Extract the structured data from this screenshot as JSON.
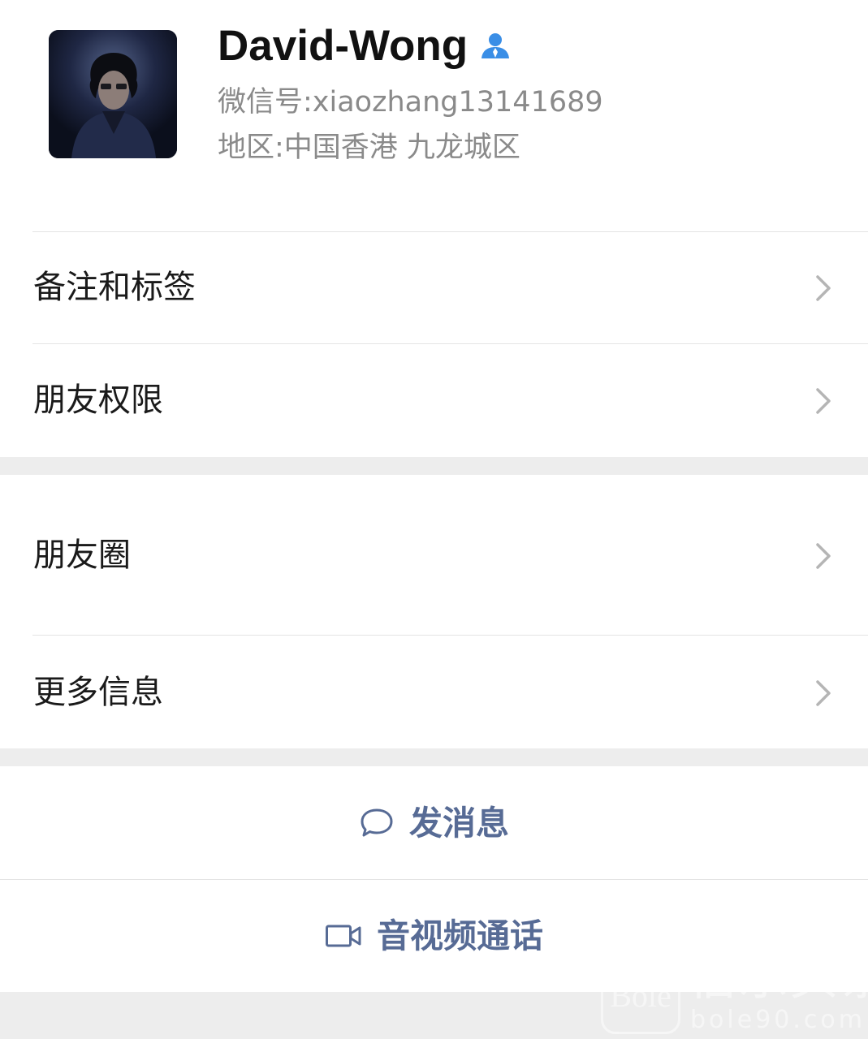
{
  "profile": {
    "name": "David-Wong",
    "wechat_id_label": "微信号:",
    "wechat_id": "xiaozhang13141689",
    "region_label": "地区:",
    "region": "中国香港 九龙城区",
    "contact_icon": "person-icon"
  },
  "menu_group_1": [
    {
      "label": "备注和标签",
      "icon": "chevron-right-icon"
    },
    {
      "label": "朋友权限",
      "icon": "chevron-right-icon"
    }
  ],
  "menu_group_2": [
    {
      "label": "朋友圈",
      "icon": "chevron-right-icon"
    },
    {
      "label": "更多信息",
      "icon": "chevron-right-icon"
    }
  ],
  "actions": {
    "send_message": {
      "label": "发消息",
      "icon": "chat-bubble-icon"
    },
    "video_call": {
      "label": "音视频通话",
      "icon": "video-camera-icon"
    }
  },
  "watermark": {
    "logo_text": "Bole",
    "title": "伯乐头条",
    "url": "bole90.com"
  },
  "colors": {
    "background": "#ededed",
    "link_blue": "#576b95",
    "contact_icon_blue": "#3a8ee6",
    "secondary_text": "#8a8a8a"
  }
}
